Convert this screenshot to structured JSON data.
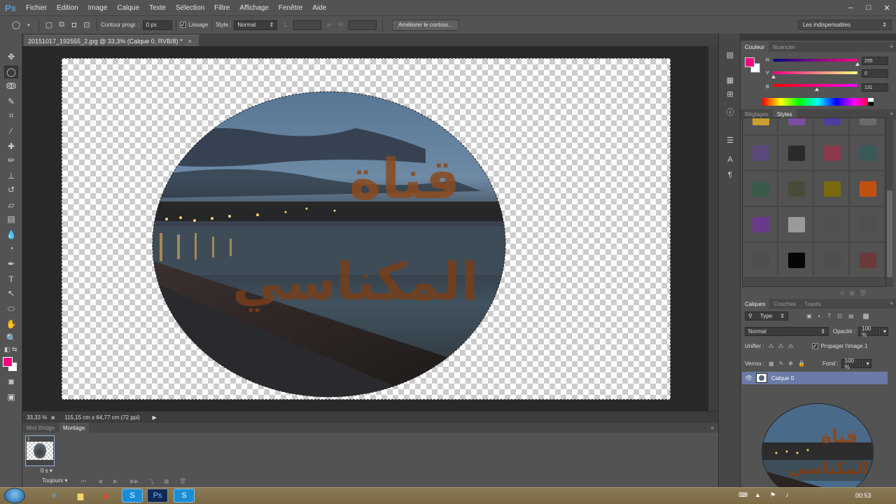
{
  "app": {
    "logo": "Ps",
    "menu": [
      "Fichier",
      "Edition",
      "Image",
      "Calque",
      "Texte",
      "Sélection",
      "Filtre",
      "Affichage",
      "Fenêtre",
      "Aide"
    ],
    "window_controls": [
      "–",
      "□",
      "✕"
    ]
  },
  "options_bar": {
    "feather_label": "Contour progr. :",
    "feather_value": "0 px",
    "antialias_label": "Lissage",
    "antialias_checked": true,
    "style_label": "Style :",
    "style_value": "Normal",
    "width_label": "L :",
    "height_label": "H :",
    "refine_button": "Améliorer le contour..."
  },
  "workspace": {
    "selected": "Les indispensables"
  },
  "document": {
    "tab_title": "20151017_192555_2.jpg @ 33,3% (Calque 0, RVB/8) *",
    "close_glyph": "×",
    "overlay_text_line1": "قناة",
    "overlay_text_line2": "المكناسي"
  },
  "status_bar": {
    "zoom": "33,33 %",
    "doc_info": "115,15 cm x 64,77 cm (72 ppi)"
  },
  "bottom_panel": {
    "tabs": [
      "Mini Bridge",
      "Montage"
    ],
    "active_tab": "Montage",
    "frame_number": "1",
    "frame_delay": "0 s",
    "loop_option": "Toujours"
  },
  "color_panel": {
    "tabs": [
      "Couleur",
      "Nuancier"
    ],
    "active_tab": "Couleur",
    "foreground": "#ff0083",
    "background": "#ffffff",
    "channels": [
      {
        "label": "R",
        "value": "255",
        "level": 1.0
      },
      {
        "label": "V",
        "value": "0",
        "level": 0.0
      },
      {
        "label": "B",
        "value": "131",
        "level": 0.514
      }
    ]
  },
  "styles_panel": {
    "tabs": [
      "Réglages",
      "Styles"
    ],
    "active_tab": "Styles",
    "swatch_colors": [
      "#c8a030",
      "#7a4fa0",
      "#4a3fa0",
      "#6a6a6a",
      "#5a4a7a",
      "#2a2a2a",
      "#8a3a4a",
      "#3a5a5a",
      "#3a5a4a",
      "#4a4a3a",
      "#7a6a10",
      "#c05010",
      "#6a3a8a",
      "#9a9a9a",
      "#505050",
      "#505050",
      "#4e4e4e",
      "#050505",
      "#4e4e4e",
      "#6a3a3a"
    ]
  },
  "layers_panel": {
    "tabs": [
      "Calques",
      "Couches",
      "Tracés"
    ],
    "active_tab": "Calques",
    "filter_label": "Type",
    "blend_mode": "Normal",
    "opacity_label": "Opacité :",
    "opacity_value": "100 %",
    "unify_label": "Unifier :",
    "propagate_label": "Propager l'image 1",
    "lock_label": "Verrou :",
    "fill_label": "Fond :",
    "fill_value": "100 %",
    "layer_name": "Calque 0"
  },
  "taskbar": {
    "clock": "00:53"
  }
}
